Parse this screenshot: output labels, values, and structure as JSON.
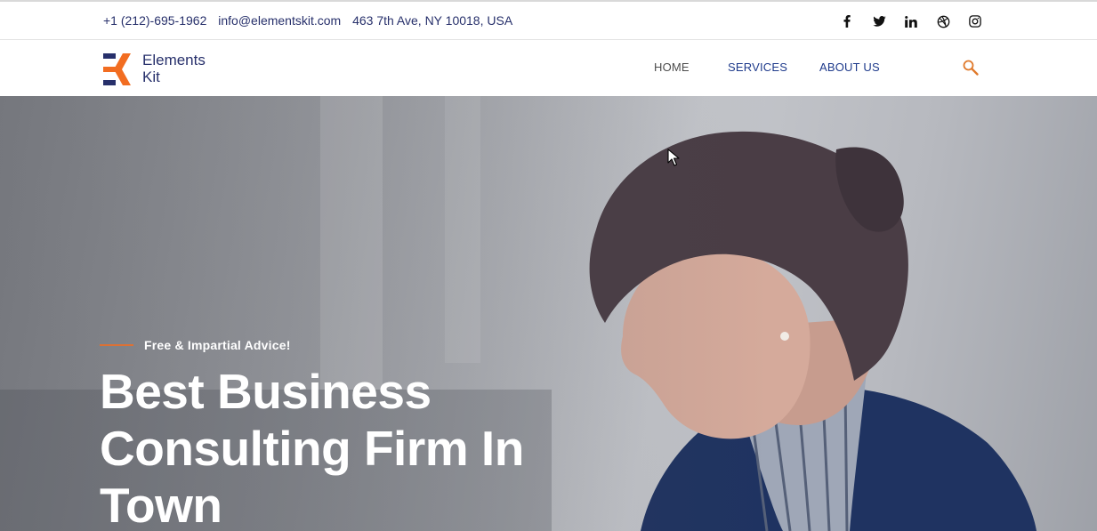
{
  "topbar": {
    "phone": "+1 (212)-695-1962",
    "email": "info@elementskit.com",
    "address": "463 7th Ave, NY 10018, USA",
    "socials": [
      "facebook-icon",
      "twitter-icon",
      "linkedin-icon",
      "dribbble-icon",
      "instagram-icon"
    ]
  },
  "header": {
    "logo_line1": "Elements",
    "logo_line2": "Kit",
    "nav": {
      "home": "HOME",
      "services": "SERVICES",
      "about": "ABOUT US"
    }
  },
  "hero": {
    "eyebrow": "Free & Impartial Advice!",
    "headline_line1": "Best Business",
    "headline_line2": "Consulting Firm In",
    "headline_line3": "Town"
  },
  "colors": {
    "brand_navy": "#27306b",
    "brand_orange": "#f26d21",
    "nav_blue": "#1f3b8c"
  }
}
